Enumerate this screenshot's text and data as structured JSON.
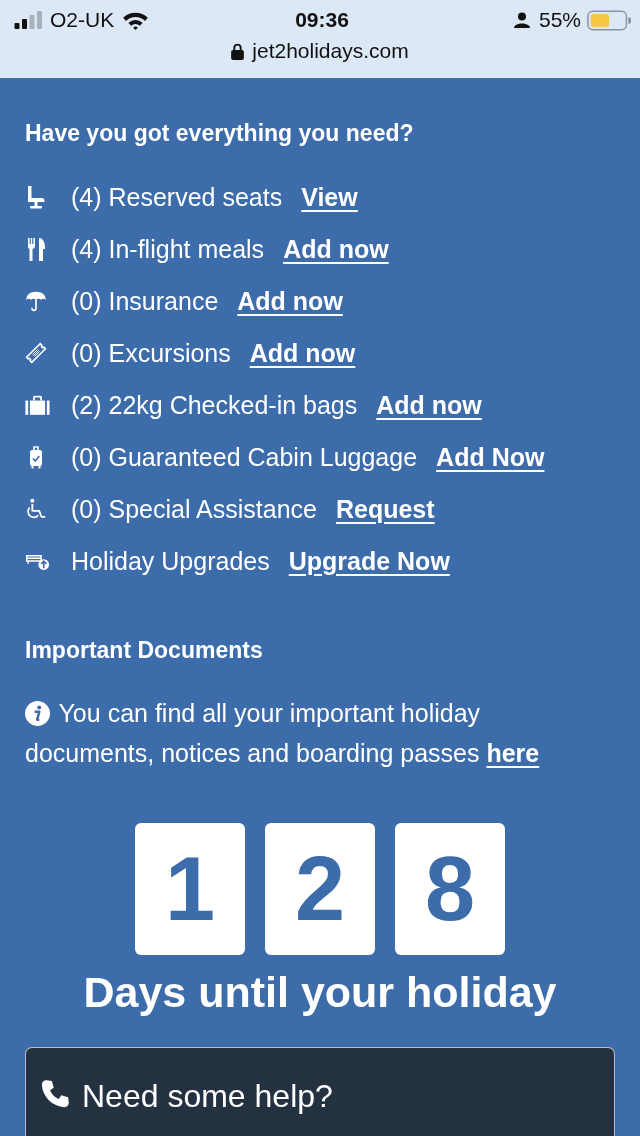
{
  "status_bar": {
    "carrier": "O2-UK",
    "time": "09:36",
    "battery": "55%",
    "url": "jet2holidays.com"
  },
  "extras": {
    "title": "Have you got everything you need?",
    "items": [
      {
        "kind": "seat",
        "label": "(4) Reserved seats",
        "action": "View"
      },
      {
        "kind": "cutlery",
        "label": "(4) In-flight meals",
        "action": "Add now"
      },
      {
        "kind": "umbrella",
        "label": "(0) Insurance",
        "action": "Add now"
      },
      {
        "kind": "ticket",
        "label": "(0) Excursions",
        "action": "Add now"
      },
      {
        "kind": "suitcase",
        "label": "(2) 22kg Checked-in bags",
        "action": "Add now"
      },
      {
        "kind": "cabinbag",
        "label": "(0) Guaranteed Cabin Luggage",
        "action": "Add Now"
      },
      {
        "kind": "wheelchair",
        "label": "(0) Special Assistance",
        "action": "Request"
      },
      {
        "kind": "upgrade",
        "label": "Holiday Upgrades",
        "action": "Upgrade Now"
      }
    ]
  },
  "documents": {
    "title": "Important Documents",
    "text": "You can find all your important holiday documents, notices and boarding passes",
    "link": "here"
  },
  "countdown": {
    "digits": [
      "1",
      "2",
      "8"
    ],
    "caption": "Days until your holiday"
  },
  "help": {
    "title": "Need some help?"
  }
}
